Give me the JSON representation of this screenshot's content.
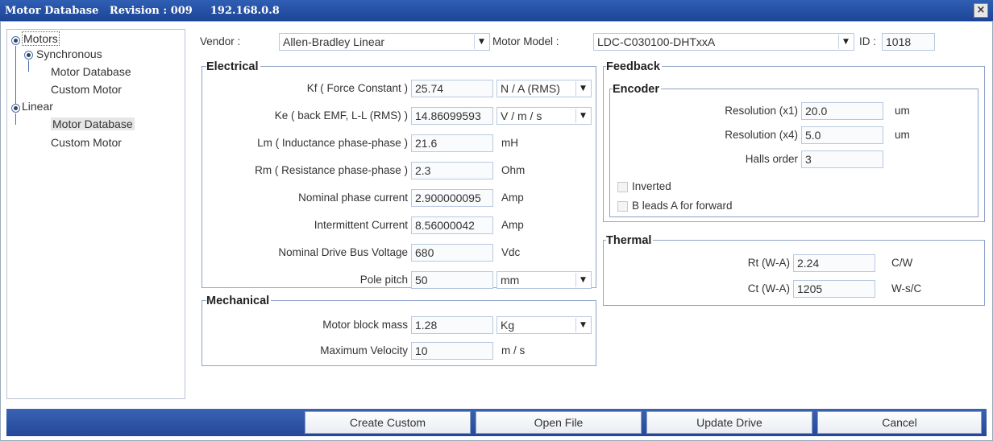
{
  "window": {
    "title": "Motor Database   Revision : 009",
    "ip": "192.168.0.8",
    "close_label": "×"
  },
  "tree": {
    "root": "Motors",
    "synchronous": "Synchronous",
    "sync_db": "Motor Database",
    "sync_custom": "Custom Motor",
    "linear": "Linear",
    "linear_db": "Motor Database",
    "linear_custom": "Custom Motor"
  },
  "top": {
    "vendor_label": "Vendor :",
    "vendor_value": "Allen-Bradley Linear",
    "model_label": "Motor Model :",
    "model_value": "LDC-C030100-DHTxxA",
    "id_label": "ID :",
    "id_value": "1018"
  },
  "electrical": {
    "title": "Electrical",
    "rows": [
      {
        "label": "Kf ( Force Constant )",
        "value": "25.74",
        "unit": "N / A (RMS)"
      },
      {
        "label": "Ke ( back EMF, L-L (RMS) )",
        "value": "14.86099593",
        "unit": "V / m / s"
      },
      {
        "label": "Lm ( Inductance phase-phase )",
        "value": "21.6",
        "unit": "mH"
      },
      {
        "label": "Rm ( Resistance phase-phase )",
        "value": "2.3",
        "unit": "Ohm"
      },
      {
        "label": "Nominal phase current",
        "value": "2.900000095",
        "unit": "Amp"
      },
      {
        "label": "Intermittent Current",
        "value": "8.56000042",
        "unit": "Amp"
      },
      {
        "label": "Nominal Drive Bus Voltage",
        "value": "680",
        "unit": "Vdc"
      },
      {
        "label": "Pole pitch",
        "value": "50",
        "unit": "mm"
      }
    ]
  },
  "mechanical": {
    "title": "Mechanical",
    "rows": [
      {
        "label": "Motor block mass",
        "value": "1.28",
        "unit": "Kg"
      },
      {
        "label": "Maximum Velocity",
        "value": "10",
        "unit": "m / s"
      }
    ]
  },
  "feedback": {
    "title": "Feedback",
    "encoder_title": "Encoder",
    "rows": [
      {
        "label": "Resolution (x1)",
        "value": "20.0",
        "unit": "um"
      },
      {
        "label": "Resolution (x4)",
        "value": "5.0",
        "unit": "um"
      },
      {
        "label": "Halls order",
        "value": "3",
        "unit": ""
      }
    ],
    "inverted_label": "Inverted",
    "bleads_label": "B leads A for forward"
  },
  "thermal": {
    "title": "Thermal",
    "rows": [
      {
        "label": "Rt (W-A)",
        "value": "2.24",
        "unit": "C/W"
      },
      {
        "label": "Ct (W-A)",
        "value": "1205",
        "unit": "W-s/C"
      }
    ]
  },
  "buttons": {
    "create_custom": "Create Custom",
    "open_file": "Open File",
    "update_drive": "Update Drive",
    "cancel": "Cancel"
  }
}
